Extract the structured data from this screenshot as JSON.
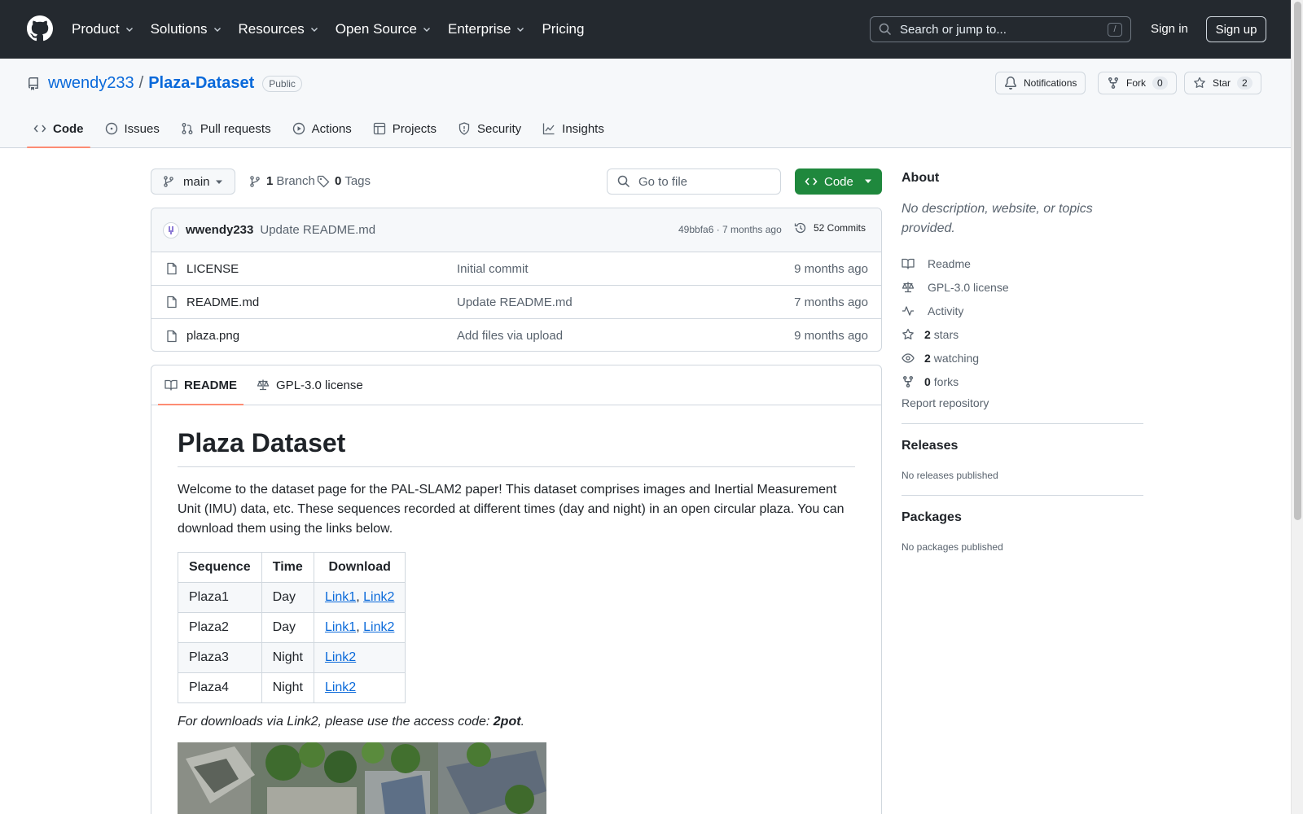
{
  "header": {
    "nav": [
      "Product",
      "Solutions",
      "Resources",
      "Open Source",
      "Enterprise",
      "Pricing"
    ],
    "search_placeholder": "Search or jump to...",
    "search_shortcut": "/",
    "signin": "Sign in",
    "signup": "Sign up"
  },
  "repo": {
    "owner": "wwendy233",
    "separator": "/",
    "name": "Plaza-Dataset",
    "visibility": "Public",
    "notifications_label": "Notifications",
    "fork_label": "Fork",
    "fork_count": "0",
    "star_label": "Star",
    "star_count": "2",
    "tabs": [
      "Code",
      "Issues",
      "Pull requests",
      "Actions",
      "Projects",
      "Security",
      "Insights"
    ]
  },
  "toolbar": {
    "branch": "main",
    "branch_count": "1",
    "branch_label": "Branch",
    "tag_count": "0",
    "tag_label": "Tags",
    "goto_placeholder": "Go to file",
    "code_label": "Code"
  },
  "commit": {
    "user": "wwendy233",
    "message": "Update README.md",
    "meta": "49bbfa6 · 7 months ago",
    "commits_label": "52 Commits"
  },
  "files": [
    {
      "name": "LICENSE",
      "message": "Initial commit",
      "age": "9 months ago"
    },
    {
      "name": "README.md",
      "message": "Update README.md",
      "age": "7 months ago"
    },
    {
      "name": "plaza.png",
      "message": "Add files via upload",
      "age": "9 months ago"
    }
  ],
  "readme": {
    "tabs": [
      "README",
      "GPL-3.0 license"
    ],
    "title": "Plaza Dataset",
    "intro": "Welcome to the dataset page for the PAL-SLAM2 paper! This dataset comprises images and Inertial Measurement Unit (IMU) data, etc. These sequences recorded at different times (day and night) in an open circular plaza. You can download them using the links below.",
    "table_headers": [
      "Sequence",
      "Time",
      "Download"
    ],
    "table_rows": [
      {
        "seq": "Plaza1",
        "time": "Day",
        "link1": "Link1",
        "comma": ",",
        "link2": "Link2"
      },
      {
        "seq": "Plaza2",
        "time": "Day",
        "link1": "Link1",
        "comma": ",",
        "link2": "Link2"
      },
      {
        "seq": "Plaza3",
        "time": "Night",
        "link2": "Link2"
      },
      {
        "seq": "Plaza4",
        "time": "Night",
        "link2": "Link2"
      }
    ],
    "note_prefix": "For downloads via Link2, please use the access code: ",
    "note_code": "2pot",
    "note_suffix": "."
  },
  "sidebar": {
    "about_title": "About",
    "description": "No description, website, or topics provided.",
    "links": [
      {
        "icon": "book-icon",
        "count": "",
        "label": "Readme"
      },
      {
        "icon": "law-icon",
        "count": "",
        "label": "GPL-3.0 license"
      },
      {
        "icon": "pulse-icon",
        "count": "",
        "label": "Activity"
      },
      {
        "icon": "star-icon",
        "count": "2",
        "label": "stars"
      },
      {
        "icon": "eye-icon",
        "count": "2",
        "label": "watching"
      },
      {
        "icon": "fork-icon",
        "count": "0",
        "label": "forks"
      }
    ],
    "report": "Report repository",
    "releases_title": "Releases",
    "releases_empty": "No releases published",
    "packages_title": "Packages",
    "packages_empty": "No packages published"
  },
  "colors": {
    "header_bg": "#24292f",
    "link": "#0969da",
    "code_button": "#1f883d",
    "active_tab_underline": "#fd8c73"
  }
}
